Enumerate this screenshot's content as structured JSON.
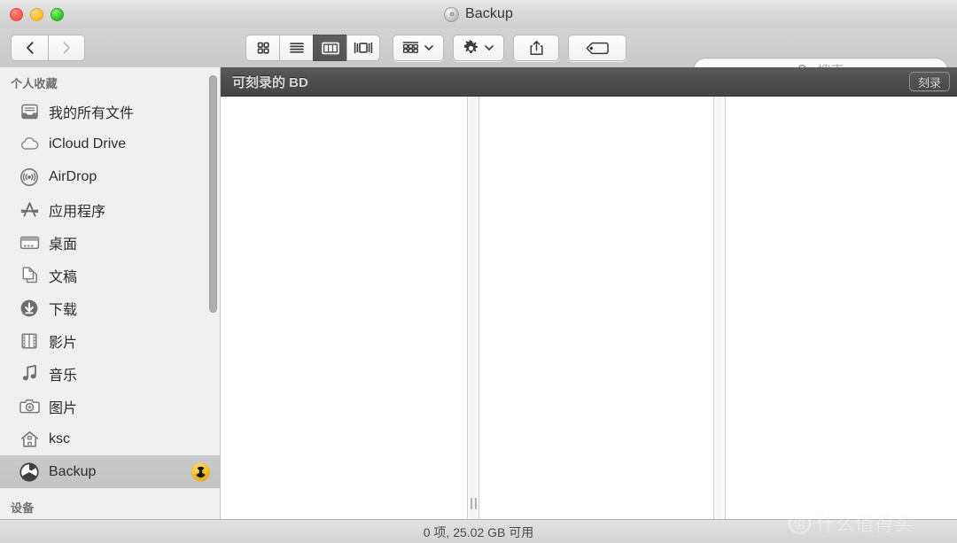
{
  "window": {
    "title": "Backup",
    "title_icon": "disc-icon",
    "traffic_lights": [
      {
        "name": "close-button",
        "color": "#fb5b52"
      },
      {
        "name": "minimize-button",
        "color": "#ffc130"
      },
      {
        "name": "zoom-button",
        "color": "#2ecb2a"
      }
    ]
  },
  "toolbar": {
    "back_icon": "chevron-left-icon",
    "forward_icon": "chevron-right-icon",
    "views": [
      {
        "name": "icon-view",
        "icon": "grid-icon",
        "active": false
      },
      {
        "name": "list-view",
        "icon": "list-icon",
        "active": false
      },
      {
        "name": "column-view",
        "icon": "columns-icon",
        "active": true
      },
      {
        "name": "coverflow-view",
        "icon": "coverflow-icon",
        "active": false
      }
    ],
    "arrange_icon": "arrange-grid-icon",
    "action_icon": "gear-icon",
    "share_icon": "share-icon",
    "tag_icon": "tag-icon",
    "dropdown_icon": "chevron-down-icon"
  },
  "search": {
    "icon": "search-icon",
    "placeholder": "搜索",
    "value": ""
  },
  "sidebar": {
    "sections": [
      {
        "header": "个人收藏",
        "items": [
          {
            "label": "我的所有文件",
            "icon": "all-my-files-icon",
            "selected": false,
            "badge": null
          },
          {
            "label": "iCloud Drive",
            "icon": "icloud-icon",
            "selected": false,
            "badge": null
          },
          {
            "label": "AirDrop",
            "icon": "airdrop-icon",
            "selected": false,
            "badge": null
          },
          {
            "label": "应用程序",
            "icon": "applications-icon",
            "selected": false,
            "badge": null
          },
          {
            "label": "桌面",
            "icon": "desktop-icon",
            "selected": false,
            "badge": null
          },
          {
            "label": "文稿",
            "icon": "documents-icon",
            "selected": false,
            "badge": null
          },
          {
            "label": "下载",
            "icon": "downloads-icon",
            "selected": false,
            "badge": null
          },
          {
            "label": "影片",
            "icon": "movies-icon",
            "selected": false,
            "badge": null
          },
          {
            "label": "音乐",
            "icon": "music-icon",
            "selected": false,
            "badge": null
          },
          {
            "label": "图片",
            "icon": "pictures-icon",
            "selected": false,
            "badge": null
          },
          {
            "label": "ksc",
            "icon": "home-icon",
            "selected": false,
            "badge": null
          },
          {
            "label": "Backup",
            "icon": "burn-folder-icon",
            "selected": true,
            "badge": "burn-badge-icon"
          }
        ]
      },
      {
        "header": "设备",
        "items": []
      }
    ],
    "scrollbar": "sidebar-scrollbar"
  },
  "content": {
    "burn_bar": {
      "label": "可刻录的 BD",
      "button_label": "刻录"
    },
    "columns": [
      {
        "name": "column-1",
        "items": []
      },
      {
        "name": "column-2",
        "items": []
      },
      {
        "name": "column-3",
        "items": []
      }
    ]
  },
  "status_bar": {
    "text": "0 项, 25.02 GB 可用"
  },
  "watermark": {
    "logo_text": "值",
    "text": "什么值得买"
  }
}
